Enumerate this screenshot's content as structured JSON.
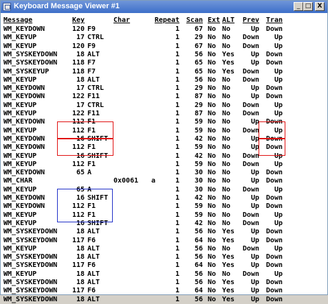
{
  "window": {
    "title": "Keyboard Message Viewer #1"
  },
  "controls": {
    "minimize": "_",
    "maximize": "□",
    "close": "X"
  },
  "headers": {
    "message": "Message",
    "key": "Key",
    "char": "Char",
    "repeat": "Repeat",
    "scan": "Scan",
    "ext": "Ext",
    "alt": "ALT",
    "prev": "Prev",
    "tran": "Tran"
  },
  "rows": [
    {
      "message": "WM_KEYDOWN",
      "key": "120",
      "keyname": "F9",
      "char": "",
      "charc": "",
      "repeat": "1",
      "scan": "67",
      "ext": "No",
      "alt": "No",
      "prev": "Up",
      "tran": "Down"
    },
    {
      "message": "WM_KEYUP",
      "key": "17",
      "keyname": "CTRL",
      "char": "",
      "charc": "",
      "repeat": "1",
      "scan": "29",
      "ext": "No",
      "alt": "No",
      "prev": "Down",
      "tran": "Up"
    },
    {
      "message": "WM_KEYUP",
      "key": "120",
      "keyname": "F9",
      "char": "",
      "charc": "",
      "repeat": "1",
      "scan": "67",
      "ext": "No",
      "alt": "No",
      "prev": "Down",
      "tran": "Up"
    },
    {
      "message": "WM_SYSKEYDOWN",
      "key": "18",
      "keyname": "ALT",
      "char": "",
      "charc": "",
      "repeat": "1",
      "scan": "56",
      "ext": "No",
      "alt": "Yes",
      "prev": "Up",
      "tran": "Down"
    },
    {
      "message": "WM_SYSKEYDOWN",
      "key": "118",
      "keyname": "F7",
      "char": "",
      "charc": "",
      "repeat": "1",
      "scan": "65",
      "ext": "No",
      "alt": "Yes",
      "prev": "Up",
      "tran": "Down"
    },
    {
      "message": "WM_SYSKEYUP",
      "key": "118",
      "keyname": "F7",
      "char": "",
      "charc": "",
      "repeat": "1",
      "scan": "65",
      "ext": "No",
      "alt": "Yes",
      "prev": "Down",
      "tran": "Up"
    },
    {
      "message": "WM_KEYUP",
      "key": "18",
      "keyname": "ALT",
      "char": "",
      "charc": "",
      "repeat": "1",
      "scan": "56",
      "ext": "No",
      "alt": "No",
      "prev": "Down",
      "tran": "Up"
    },
    {
      "message": "WM_KEYDOWN",
      "key": "17",
      "keyname": "CTRL",
      "char": "",
      "charc": "",
      "repeat": "1",
      "scan": "29",
      "ext": "No",
      "alt": "No",
      "prev": "Up",
      "tran": "Down"
    },
    {
      "message": "WM_KEYDOWN",
      "key": "122",
      "keyname": "F11",
      "char": "",
      "charc": "",
      "repeat": "1",
      "scan": "87",
      "ext": "No",
      "alt": "No",
      "prev": "Up",
      "tran": "Down"
    },
    {
      "message": "WM_KEYUP",
      "key": "17",
      "keyname": "CTRL",
      "char": "",
      "charc": "",
      "repeat": "1",
      "scan": "29",
      "ext": "No",
      "alt": "No",
      "prev": "Down",
      "tran": "Up"
    },
    {
      "message": "WM_KEYUP",
      "key": "122",
      "keyname": "F11",
      "char": "",
      "charc": "",
      "repeat": "1",
      "scan": "87",
      "ext": "No",
      "alt": "No",
      "prev": "Down",
      "tran": "Up"
    },
    {
      "message": "WM_KEYDOWN",
      "key": "112",
      "keyname": "F1",
      "char": "",
      "charc": "",
      "repeat": "1",
      "scan": "59",
      "ext": "No",
      "alt": "No",
      "prev": "Up",
      "tran": "Down"
    },
    {
      "message": "WM_KEYUP",
      "key": "112",
      "keyname": "F1",
      "char": "",
      "charc": "",
      "repeat": "1",
      "scan": "59",
      "ext": "No",
      "alt": "No",
      "prev": "Down",
      "tran": "Up"
    },
    {
      "message": "WM_KEYDOWN",
      "key": "16",
      "keyname": "SHIFT",
      "char": "",
      "charc": "",
      "repeat": "1",
      "scan": "42",
      "ext": "No",
      "alt": "No",
      "prev": "Up",
      "tran": "Down"
    },
    {
      "message": "WM_KEYDOWN",
      "key": "112",
      "keyname": "F1",
      "char": "",
      "charc": "",
      "repeat": "1",
      "scan": "59",
      "ext": "No",
      "alt": "No",
      "prev": "Up",
      "tran": "Down"
    },
    {
      "message": "WM_KEYUP",
      "key": "16",
      "keyname": "SHIFT",
      "char": "",
      "charc": "",
      "repeat": "1",
      "scan": "42",
      "ext": "No",
      "alt": "No",
      "prev": "Down",
      "tran": "Up"
    },
    {
      "message": "WM_KEYUP",
      "key": "112",
      "keyname": "F1",
      "char": "",
      "charc": "",
      "repeat": "1",
      "scan": "59",
      "ext": "No",
      "alt": "No",
      "prev": "Down",
      "tran": "Up"
    },
    {
      "message": "WM_KEYDOWN",
      "key": "65",
      "keyname": "A",
      "char": "",
      "charc": "",
      "repeat": "1",
      "scan": "30",
      "ext": "No",
      "alt": "No",
      "prev": "Up",
      "tran": "Down"
    },
    {
      "message": "WM_CHAR",
      "key": "",
      "keyname": "",
      "char": "0x0061",
      "charc": "a",
      "repeat": "1",
      "scan": "30",
      "ext": "No",
      "alt": "No",
      "prev": "Up",
      "tran": "Down"
    },
    {
      "message": "WM_KEYUP",
      "key": "65",
      "keyname": "A",
      "char": "",
      "charc": "",
      "repeat": "1",
      "scan": "30",
      "ext": "No",
      "alt": "No",
      "prev": "Down",
      "tran": "Up"
    },
    {
      "message": "WM_KEYDOWN",
      "key": "16",
      "keyname": "SHIFT",
      "char": "",
      "charc": "",
      "repeat": "1",
      "scan": "42",
      "ext": "No",
      "alt": "No",
      "prev": "Up",
      "tran": "Down"
    },
    {
      "message": "WM_KEYDOWN",
      "key": "112",
      "keyname": "F1",
      "char": "",
      "charc": "",
      "repeat": "1",
      "scan": "59",
      "ext": "No",
      "alt": "No",
      "prev": "Up",
      "tran": "Down"
    },
    {
      "message": "WM_KEYUP",
      "key": "112",
      "keyname": "F1",
      "char": "",
      "charc": "",
      "repeat": "1",
      "scan": "59",
      "ext": "No",
      "alt": "No",
      "prev": "Down",
      "tran": "Up"
    },
    {
      "message": "WM_KEYUP",
      "key": "16",
      "keyname": "SHIFT",
      "char": "",
      "charc": "",
      "repeat": "1",
      "scan": "42",
      "ext": "No",
      "alt": "No",
      "prev": "Down",
      "tran": "Up"
    },
    {
      "message": "WM_SYSKEYDOWN",
      "key": "18",
      "keyname": "ALT",
      "char": "",
      "charc": "",
      "repeat": "1",
      "scan": "56",
      "ext": "No",
      "alt": "Yes",
      "prev": "Up",
      "tran": "Down"
    },
    {
      "message": "WM_SYSKEYDOWN",
      "key": "117",
      "keyname": "F6",
      "char": "",
      "charc": "",
      "repeat": "1",
      "scan": "64",
      "ext": "No",
      "alt": "Yes",
      "prev": "Up",
      "tran": "Down"
    },
    {
      "message": "WM_KEYUP",
      "key": "18",
      "keyname": "ALT",
      "char": "",
      "charc": "",
      "repeat": "1",
      "scan": "56",
      "ext": "No",
      "alt": "No",
      "prev": "Down",
      "tran": "Up"
    },
    {
      "message": "WM_SYSKEYDOWN",
      "key": "18",
      "keyname": "ALT",
      "char": "",
      "charc": "",
      "repeat": "1",
      "scan": "56",
      "ext": "No",
      "alt": "Yes",
      "prev": "Up",
      "tran": "Down"
    },
    {
      "message": "WM_SYSKEYDOWN",
      "key": "117",
      "keyname": "F6",
      "char": "",
      "charc": "",
      "repeat": "1",
      "scan": "64",
      "ext": "No",
      "alt": "Yes",
      "prev": "Up",
      "tran": "Down"
    },
    {
      "message": "WM_KEYUP",
      "key": "18",
      "keyname": "ALT",
      "char": "",
      "charc": "",
      "repeat": "1",
      "scan": "56",
      "ext": "No",
      "alt": "No",
      "prev": "Down",
      "tran": "Up"
    },
    {
      "message": "WM_SYSKEYDOWN",
      "key": "18",
      "keyname": "ALT",
      "char": "",
      "charc": "",
      "repeat": "1",
      "scan": "56",
      "ext": "No",
      "alt": "Yes",
      "prev": "Up",
      "tran": "Down"
    },
    {
      "message": "WM_SYSKEYDOWN",
      "key": "117",
      "keyname": "F6",
      "char": "",
      "charc": "",
      "repeat": "1",
      "scan": "64",
      "ext": "No",
      "alt": "Yes",
      "prev": "Up",
      "tran": "Down"
    },
    {
      "message": "WM_SYSKEYDOWN",
      "key": "18",
      "keyname": "ALT",
      "char": "",
      "charc": "",
      "repeat": "1",
      "scan": "56",
      "ext": "No",
      "alt": "Yes",
      "prev": "Up",
      "tran": "Down"
    }
  ],
  "annotations": {
    "red_color": "#e01010",
    "blue_color": "#2030c8"
  }
}
